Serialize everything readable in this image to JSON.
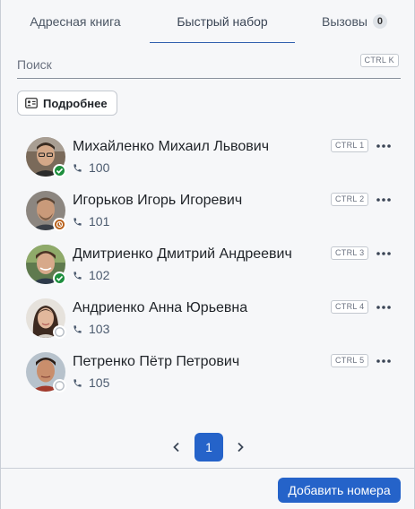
{
  "tabs": [
    {
      "label": "Адресная книга"
    },
    {
      "label": "Быстрый набор"
    },
    {
      "label": "Вызовы",
      "badge": "0"
    }
  ],
  "active_tab": "Быстрый набор",
  "search": {
    "placeholder": "Поиск",
    "shortcut": "CTRL K"
  },
  "details_button": {
    "label": "Подробнее",
    "icon": "contact-card-icon"
  },
  "contacts": [
    {
      "name": "Михайленко Михаил Львович",
      "number": "100",
      "shortcut": "CTRL 1",
      "status": "online"
    },
    {
      "name": "Игорьков Игорь Игоревич",
      "number": "101",
      "shortcut": "CTRL 2",
      "status": "away"
    },
    {
      "name": "Дмитриенко Дмитрий Андреевич",
      "number": "102",
      "shortcut": "CTRL 3",
      "status": "online"
    },
    {
      "name": "Андриенко Анна Юрьевна",
      "number": "103",
      "shortcut": "CTRL 4",
      "status": "offline"
    },
    {
      "name": "Петренко Пётр Петрович",
      "number": "105",
      "shortcut": "CTRL 5",
      "status": "offline"
    }
  ],
  "pagination": {
    "current_page": "1"
  },
  "footer": {
    "add_button_label": "Добавить номера"
  },
  "colors": {
    "accent": "#2563c9",
    "online": "#1e8e3e",
    "away": "#b9611b"
  }
}
